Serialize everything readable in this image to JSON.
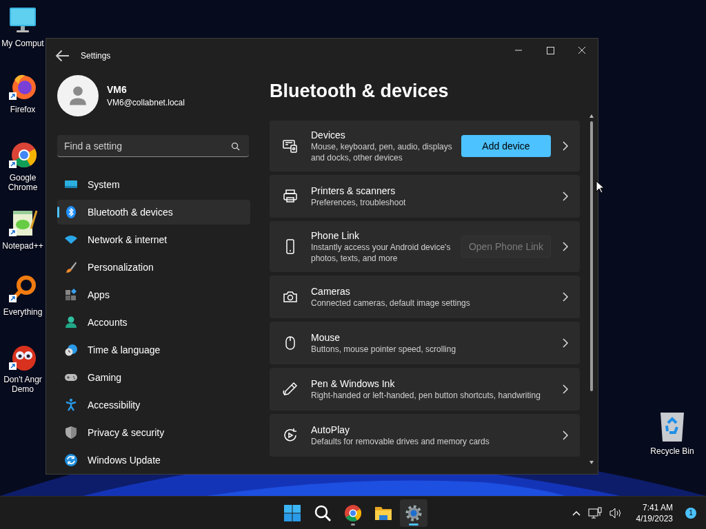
{
  "desktop_icons": [
    {
      "label": "My Comput",
      "shortcut": false
    },
    {
      "label": "Firefox",
      "shortcut": true
    },
    {
      "label": "Google Chrome",
      "shortcut": true
    },
    {
      "label": "Notepad++",
      "shortcut": true
    },
    {
      "label": "Everything",
      "shortcut": true
    },
    {
      "label": "Don't Angr Demo",
      "shortcut": true
    }
  ],
  "recycle_bin": {
    "label": "Recycle Bin"
  },
  "window": {
    "title": "Settings",
    "user": {
      "name": "VM6",
      "email": "VM6@collabnet.local"
    },
    "search": {
      "placeholder": "Find a setting"
    },
    "nav": [
      {
        "label": "System",
        "selected": false
      },
      {
        "label": "Bluetooth & devices",
        "selected": true
      },
      {
        "label": "Network & internet",
        "selected": false
      },
      {
        "label": "Personalization",
        "selected": false
      },
      {
        "label": "Apps",
        "selected": false
      },
      {
        "label": "Accounts",
        "selected": false
      },
      {
        "label": "Time & language",
        "selected": false
      },
      {
        "label": "Gaming",
        "selected": false
      },
      {
        "label": "Accessibility",
        "selected": false
      },
      {
        "label": "Privacy & security",
        "selected": false
      },
      {
        "label": "Windows Update",
        "selected": false
      }
    ],
    "page_title": "Bluetooth & devices",
    "cards": [
      {
        "title": "Devices",
        "description": "Mouse, keyboard, pen, audio, displays and docks, other devices",
        "button": {
          "label": "Add device",
          "disabled": false
        }
      },
      {
        "title": "Printers & scanners",
        "description": "Preferences, troubleshoot"
      },
      {
        "title": "Phone Link",
        "description": "Instantly access your Android device's photos, texts, and more",
        "button": {
          "label": "Open Phone Link",
          "disabled": true
        }
      },
      {
        "title": "Cameras",
        "description": "Connected cameras, default image settings"
      },
      {
        "title": "Mouse",
        "description": "Buttons, mouse pointer speed, scrolling"
      },
      {
        "title": "Pen & Windows Ink",
        "description": "Right-handed or left-handed, pen button shortcuts, handwriting"
      },
      {
        "title": "AutoPlay",
        "description": "Defaults for removable drives and memory cards"
      }
    ]
  },
  "taskbar": {
    "apps": [
      {
        "running": false,
        "selected": false
      },
      {
        "running": false,
        "selected": false
      },
      {
        "running": true,
        "selected": false
      },
      {
        "running": false,
        "selected": false
      },
      {
        "running": true,
        "selected": true
      }
    ],
    "time": "7:41 AM",
    "date": "4/19/2023",
    "notifications": "1"
  }
}
